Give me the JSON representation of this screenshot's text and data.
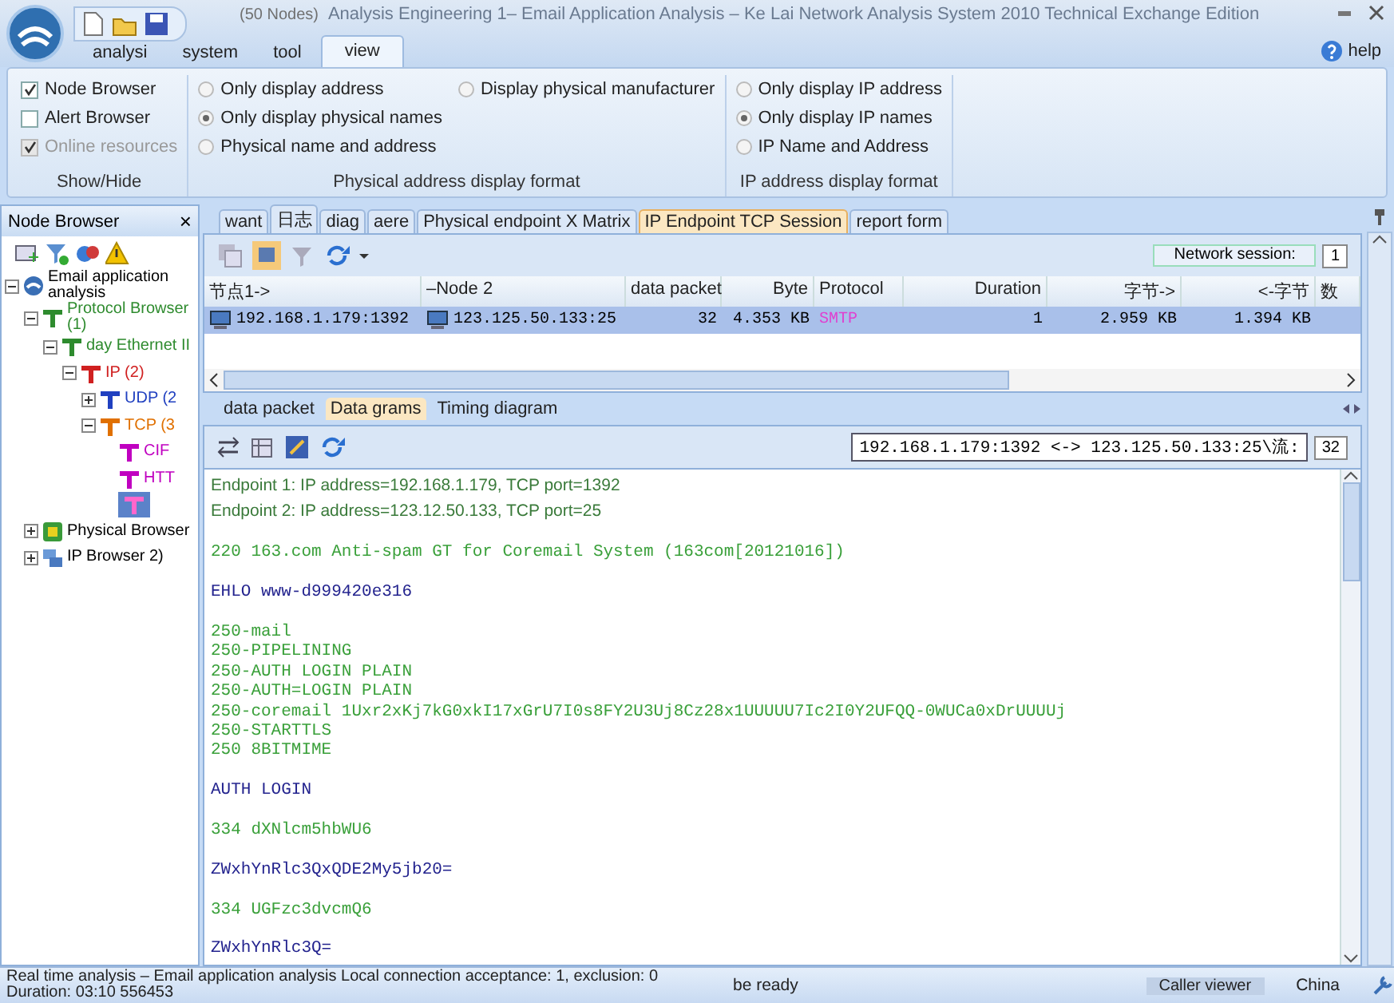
{
  "window": {
    "title": "Analysis Engineering 1– Email Application Analysis – Ke Lai Network Analysis System 2010 Technical Exchange Edition",
    "subtitle": "(50 Nodes)"
  },
  "menu": [
    {
      "label": "analysi",
      "selected": false
    },
    {
      "label": "system",
      "selected": false
    },
    {
      "label": "tool",
      "selected": false
    },
    {
      "label": "view",
      "selected": true
    }
  ],
  "help": "help",
  "ribbon": [
    {
      "caption": "Show/Hide",
      "items": [
        {
          "kind": "checkbox",
          "label": "Node Browser",
          "checked": true,
          "disabled": false
        },
        {
          "kind": "checkbox",
          "label": "Alert Browser",
          "checked": false,
          "disabled": false
        },
        {
          "kind": "checkbox",
          "label": "Online resources",
          "checked": true,
          "disabled": true
        }
      ]
    },
    {
      "caption": "Physical address display format",
      "items": [
        {
          "kind": "radio",
          "label": "Only display address",
          "selected": false
        },
        {
          "kind": "radio",
          "label": "Only display physical names",
          "selected": true
        },
        {
          "kind": "radio",
          "label": "Physical name and address",
          "selected": false
        },
        {
          "kind": "radio",
          "label": "Display physical manufacturer",
          "selected": false
        }
      ]
    },
    {
      "caption": "IP address display format",
      "items": [
        {
          "kind": "radio",
          "label": "Only display IP address",
          "selected": false
        },
        {
          "kind": "radio",
          "label": "Only display IP names",
          "selected": true
        },
        {
          "kind": "radio",
          "label": "IP Name and Address",
          "selected": false
        }
      ]
    }
  ],
  "node_browser": {
    "title": "Node Browser",
    "close": "×",
    "tree": [
      {
        "label": "Email application analysis",
        "kind": "root",
        "expanded": true,
        "selected": false,
        "children": [
          {
            "label": "Protocol Browser (1)",
            "kind": "protocol",
            "expanded": true,
            "selected": false,
            "color": "#2e8b2e",
            "children": [
              {
                "label": "day Ethernet II",
                "kind": "protocol",
                "expanded": true,
                "selected": false,
                "color": "#2e8b2e",
                "children": [
                  {
                    "label": "IP (2)",
                    "kind": "protocol",
                    "expanded": true,
                    "selected": false,
                    "color": "#d02020",
                    "children": [
                      {
                        "label": "UDP (2",
                        "kind": "protocol",
                        "expanded": false,
                        "selected": false,
                        "color": "#2040c0"
                      },
                      {
                        "label": "TCP (3",
                        "kind": "protocol",
                        "expanded": true,
                        "selected": false,
                        "color": "#e07000",
                        "children": [
                          {
                            "label": "CIF",
                            "kind": "protocol",
                            "selected": false,
                            "color": "#c000c0"
                          },
                          {
                            "label": "HTT",
                            "kind": "protocol",
                            "selected": false,
                            "color": "#c000c0"
                          },
                          {
                            "kind": "protocol",
                            "selected": true,
                            "color": "#ff66cc"
                          }
                        ]
                      }
                    ]
                  }
                ]
              }
            ]
          },
          {
            "label": "Physical Browser",
            "kind": "physical",
            "expanded": false,
            "selected": false
          },
          {
            "label": "IP Browser 2)",
            "kind": "ip",
            "expanded": false,
            "selected": false
          }
        ]
      }
    ]
  },
  "view_tabs": [
    {
      "label": "want",
      "selected": false
    },
    {
      "label": "日志",
      "selected": false
    },
    {
      "label": "diag",
      "selected": false
    },
    {
      "label": "aere",
      "selected": false
    },
    {
      "label": "Physical endpoint X Matrix",
      "selected": false
    },
    {
      "label": "IP Endpoint TCP Session",
      "selected": true
    },
    {
      "label": "report form",
      "selected": false
    }
  ],
  "session": {
    "counter_label": "Network session:",
    "counter": "1",
    "columns": [
      "节点1->",
      "–Node 2",
      "data packet",
      "Byte",
      "Protocol",
      "Duration",
      "字节->",
      "<-字节",
      "数"
    ],
    "rows": [
      {
        "selected": true,
        "cells": [
          "192.168.1.179:1392",
          "123.125.50.133:25",
          "32",
          "4.353 KB",
          "SMTP",
          "1",
          "2.959 KB",
          "1.394 KB",
          ""
        ]
      }
    ]
  },
  "detail_tabs": [
    {
      "label": "data packet",
      "selected": false
    },
    {
      "label": "Data grams",
      "selected": true
    },
    {
      "label": "Timing diagram",
      "selected": false
    }
  ],
  "stream": {
    "selector": "192.168.1.179:1392 <-> 123.125.50.133:25\\流:",
    "count": "32",
    "lines": [
      {
        "kind": "endpoint",
        "text": "Endpoint 1: IP address=192.168.1.179, TCP port=1392"
      },
      {
        "kind": "endpoint",
        "text": "Endpoint 2: IP address=123.12.50.133, TCP port=25"
      },
      {
        "kind": "blank"
      },
      {
        "kind": "server",
        "text": "220 163.com Anti-spam GT for Coremail System (163com[20121016])"
      },
      {
        "kind": "blank"
      },
      {
        "kind": "client",
        "text": "EHLO www-d999420e316"
      },
      {
        "kind": "blank"
      },
      {
        "kind": "server",
        "text": "250-mail"
      },
      {
        "kind": "server",
        "text": "250-PIPELINING"
      },
      {
        "kind": "server",
        "text": "250-AUTH LOGIN PLAIN"
      },
      {
        "kind": "server",
        "text": "250-AUTH=LOGIN PLAIN"
      },
      {
        "kind": "server",
        "text": "250-coremail 1Uxr2xKj7kG0xkI17xGrU7I0s8FY2U3Uj8Cz28x1UUUUU7Ic2I0Y2UFQQ-0WUCa0xDrUUUUj"
      },
      {
        "kind": "server",
        "text": "250-STARTTLS"
      },
      {
        "kind": "server",
        "text": "250 8BITMIME"
      },
      {
        "kind": "blank"
      },
      {
        "kind": "client",
        "text": "AUTH LOGIN"
      },
      {
        "kind": "blank"
      },
      {
        "kind": "server",
        "text": "334 dXNlcm5hbWU6"
      },
      {
        "kind": "blank"
      },
      {
        "kind": "client",
        "text": "ZWxhYnRlc3QxQDE2My5jb20="
      },
      {
        "kind": "blank"
      },
      {
        "kind": "server",
        "text": "334 UGFzc3dvcmQ6"
      },
      {
        "kind": "blank"
      },
      {
        "kind": "client",
        "text": "ZWxhYnRlc3Q="
      }
    ]
  },
  "status_bar": [
    "Real time analysis – Email application analysis Local connection acceptance: 1, exclusion: 0 Duration: 03:10 556453",
    "be ready",
    "Caller viewer",
    "China"
  ]
}
